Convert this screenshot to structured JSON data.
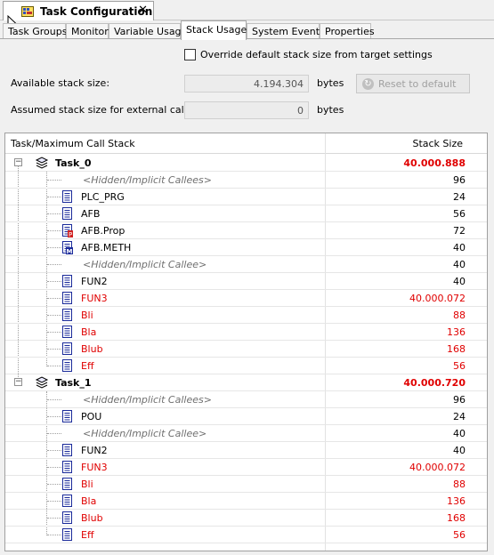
{
  "window": {
    "tab_title": "Task Configuration",
    "close_glyph": "✕"
  },
  "sub_tabs": [
    {
      "label": "Task Groups",
      "active": false
    },
    {
      "label": "Monitor",
      "active": false
    },
    {
      "label": "Variable Usage",
      "active": false
    },
    {
      "label": "Stack Usage",
      "active": true
    },
    {
      "label": "System Events",
      "active": false
    },
    {
      "label": "Properties",
      "active": false
    }
  ],
  "settings": {
    "override_label": "Override default stack size from target settings",
    "override_checked": false,
    "available_label": "Available stack size:",
    "available_value": "4.194.304",
    "available_unit": "bytes",
    "reset_label": "Reset to default",
    "assumed_label": "Assumed stack size for external calls:",
    "assumed_value": "0",
    "assumed_unit": "bytes"
  },
  "grid": {
    "col_task": "Task/Maximum Call Stack",
    "col_size": "Stack Size",
    "rows": [
      {
        "kind": "task",
        "name": "Task_0",
        "value": "40.000.888"
      },
      {
        "kind": "hidden",
        "name": "<Hidden/Implicit Callees>",
        "value": "96"
      },
      {
        "kind": "prg",
        "name": "PLC_PRG",
        "value": "24"
      },
      {
        "kind": "fb",
        "name": "AFB",
        "value": "56"
      },
      {
        "kind": "prop",
        "name": "AFB.Prop",
        "value": "72"
      },
      {
        "kind": "meth",
        "name": "AFB.METH",
        "value": "40"
      },
      {
        "kind": "hidden",
        "name": "<Hidden/Implicit Callee>",
        "value": "40"
      },
      {
        "kind": "fun",
        "name": "FUN2",
        "value": "40"
      },
      {
        "kind": "fun-red",
        "name": "FUN3",
        "value": "40.000.072"
      },
      {
        "kind": "fun-red",
        "name": "Bli",
        "value": "88"
      },
      {
        "kind": "fun-red",
        "name": "Bla",
        "value": "136"
      },
      {
        "kind": "fun-red",
        "name": "Blub",
        "value": "168"
      },
      {
        "kind": "fun-red",
        "name": "Eff",
        "value": "56"
      },
      {
        "kind": "task",
        "name": "Task_1",
        "value": "40.000.720"
      },
      {
        "kind": "hidden",
        "name": "<Hidden/Implicit Callees>",
        "value": "96"
      },
      {
        "kind": "prg",
        "name": "POU",
        "value": "24"
      },
      {
        "kind": "hidden",
        "name": "<Hidden/Implicit Callee>",
        "value": "40"
      },
      {
        "kind": "fun",
        "name": "FUN2",
        "value": "40"
      },
      {
        "kind": "fun-red",
        "name": "FUN3",
        "value": "40.000.072"
      },
      {
        "kind": "fun-red",
        "name": "Bli",
        "value": "88"
      },
      {
        "kind": "fun-red",
        "name": "Bla",
        "value": "136"
      },
      {
        "kind": "fun-red",
        "name": "Blub",
        "value": "168"
      },
      {
        "kind": "fun-red",
        "name": "Eff",
        "value": "56"
      }
    ]
  },
  "colors": {
    "warning_red": "#e00000",
    "hidden_gray": "#707070"
  }
}
